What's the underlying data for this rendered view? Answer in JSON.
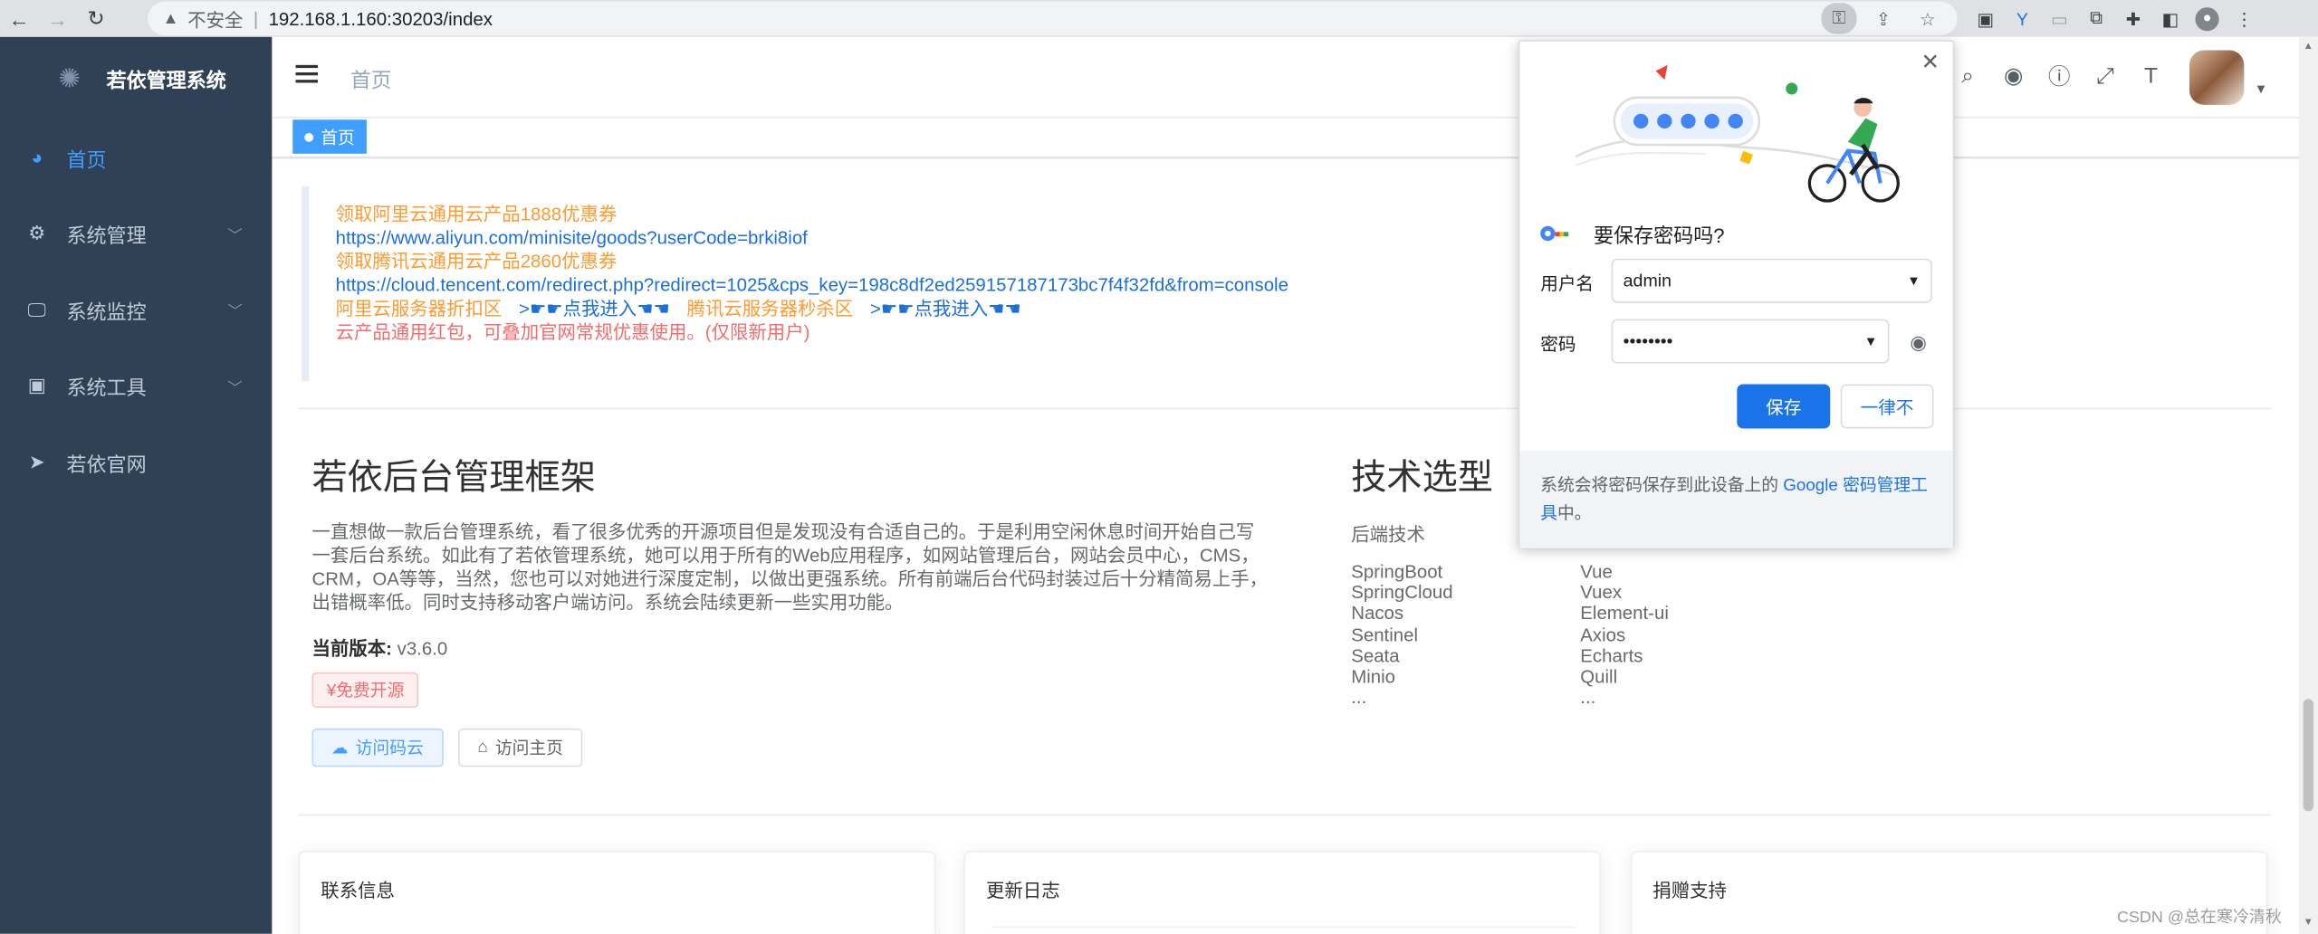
{
  "browser": {
    "security_label": "不安全",
    "url": "192.168.1.160:30203/index",
    "back_icon": "←",
    "forward_icon": "→",
    "reload_icon": "↻"
  },
  "sidebar": {
    "logo_text": "若依管理系统",
    "items": [
      {
        "label": "首页",
        "icon": "dashboard-icon",
        "active": true
      },
      {
        "label": "系统管理",
        "icon": "gear-icon"
      },
      {
        "label": "系统监控",
        "icon": "monitor-icon"
      },
      {
        "label": "系统工具",
        "icon": "toolbox-icon"
      },
      {
        "label": "若依官网",
        "icon": "send-icon"
      }
    ]
  },
  "header": {
    "breadcrumb": "首页"
  },
  "tags": {
    "active": "首页"
  },
  "promo": {
    "line1": "领取阿里云通用云产品1888优惠券",
    "line2": "https://www.aliyun.com/minisite/goods?userCode=brki8iof",
    "line3": "领取腾讯云通用云产品2860优惠券",
    "line4": "https://cloud.tencent.com/redirect.php?redirect=1025&cps_key=198c8df2ed259157187173bc7f4f32fd&from=console",
    "line5_a": "阿里云服务器折扣区",
    "line5_b": ">☛☛点我进入☚☚",
    "line5_c": "腾讯云服务器秒杀区",
    "line5_d": ">☛☛点我进入☚☚",
    "line6": "云产品通用红包，可叠加官网常规优惠使用。(仅限新用户)"
  },
  "intro": {
    "title": "若依后台管理框架",
    "desc": "一直想做一款后台管理系统，看了很多优秀的开源项目但是发现没有合适自己的。于是利用空闲休息时间开始自己写一套后台系统。如此有了若依管理系统，她可以用于所有的Web应用程序，如网站管理后台，网站会员中心，CMS，CRM，OA等等，当然，您也可以对她进行深度定制，以做出更强系统。所有前端后台代码封装过后十分精简易上手，出错概率低。同时支持移动客户端访问。系统会陆续更新一些实用功能。",
    "version_label": "当前版本:",
    "version": "v3.6.0",
    "free_tag": "¥免费开源",
    "btn_gitee": "访问码云",
    "btn_home": "访问主页"
  },
  "tech": {
    "title": "技术选型",
    "backend_label": "后端技术",
    "backend": [
      "SpringBoot",
      "SpringCloud",
      "Nacos",
      "Sentinel",
      "Seata",
      "Minio",
      "..."
    ],
    "frontend": [
      "Vue",
      "Vuex",
      "Element-ui",
      "Axios",
      "Echarts",
      "Quill",
      "..."
    ]
  },
  "cards": [
    "联系信息",
    "更新日志",
    "捐赠支持"
  ],
  "password_popup": {
    "title": "要保存密码吗?",
    "username_label": "用户名",
    "username": "admin",
    "password_label": "密码",
    "password": "••••••••",
    "save": "保存",
    "never": "一律不",
    "footer_a": "系统会将密码保存到此设备上的 ",
    "footer_link": "Google 密码管理工具",
    "footer_b": "中。"
  },
  "watermark": "CSDN @总在寒冷清秋"
}
